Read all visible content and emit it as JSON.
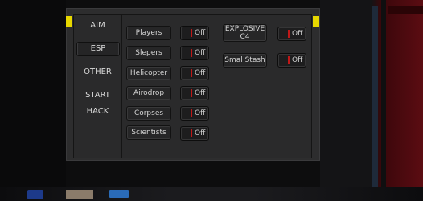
{
  "menu": {
    "tabs": [
      {
        "label": "AIM"
      },
      {
        "label": "ESP"
      },
      {
        "label": "OTHER"
      },
      {
        "label": "START HACK"
      }
    ],
    "active_tab": "ESP"
  },
  "esp": {
    "left_features": [
      {
        "label": "Players",
        "state": "Off"
      },
      {
        "label": "Slepers",
        "state": "Off"
      },
      {
        "label": "Helicopter",
        "state": "Off"
      },
      {
        "label": "Airodrop",
        "state": "Off"
      },
      {
        "label": "Corpses",
        "state": "Off"
      },
      {
        "label": "Scientists",
        "state": "Off"
      }
    ],
    "right_features": [
      {
        "label_line1": "EXPLOSIVE",
        "label_line2": "C4",
        "state": "Off"
      },
      {
        "label": "Smal Stash",
        "state": "Off"
      }
    ]
  },
  "colors": {
    "handle": "#e8d800",
    "toggle_off_indicator": "#c01818",
    "panel": "#2a2a2b"
  }
}
